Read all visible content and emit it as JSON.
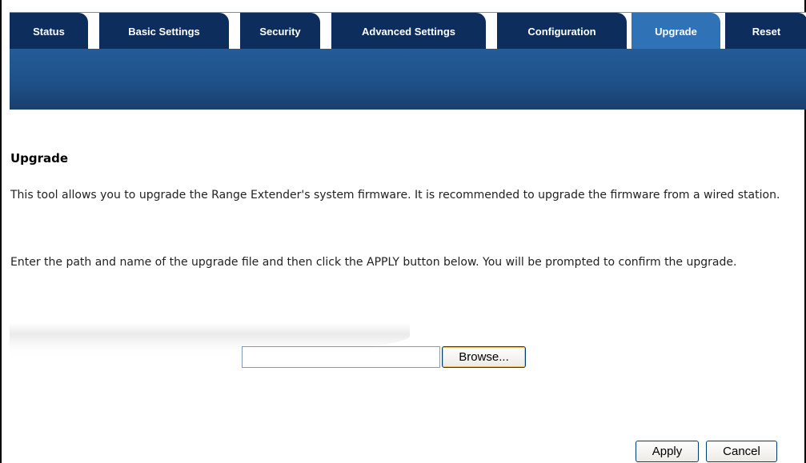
{
  "tabs": [
    {
      "label": "Status",
      "active": false
    },
    {
      "label": "Basic Settings",
      "active": false
    },
    {
      "label": "Security",
      "active": false
    },
    {
      "label": "Advanced Settings",
      "active": false
    },
    {
      "label": "Configuration",
      "active": false
    },
    {
      "label": "Upgrade",
      "active": true
    },
    {
      "label": "Reset",
      "active": false
    }
  ],
  "page": {
    "heading": "Upgrade",
    "description_1": "This tool allows you to upgrade the Range Extender's system firmware. It is recommended to upgrade the firmware from a wired station.",
    "description_2": "Enter the path and name of the upgrade file and then click the APPLY button below. You will be prompted to confirm the upgrade."
  },
  "upload": {
    "file_value": "",
    "browse_label": "Browse..."
  },
  "actions": {
    "apply_label": "Apply",
    "cancel_label": "Cancel"
  },
  "colors": {
    "tab_bg": "#0d2e5c",
    "tab_active_bg": "#2f72b6",
    "band": "#1e5189"
  }
}
